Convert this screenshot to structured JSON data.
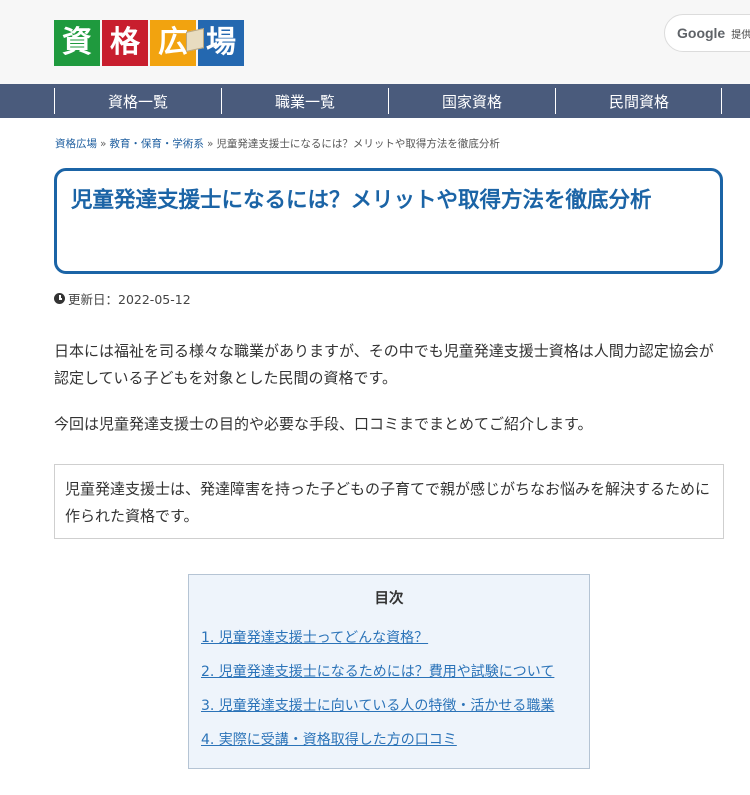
{
  "header": {
    "logo": {
      "chars": [
        "資",
        "格",
        "広",
        "場"
      ],
      "colors": [
        "#1f9a3e",
        "#c81e2e",
        "#f2a30f",
        "#2468b0"
      ]
    },
    "google_button": {
      "brand": "Google",
      "label_fragment": "提供"
    }
  },
  "nav": {
    "items": [
      "資格一覧",
      "職業一覧",
      "国家資格",
      "民間資格"
    ]
  },
  "breadcrumb": {
    "items": [
      "資格広場",
      "教育・保育・学術系",
      "児童発達支援士になるには？メリットや取得方法を徹底分析"
    ],
    "separator": "»"
  },
  "article": {
    "title": "児童発達支援士になるには？メリットや取得方法を徹底分析",
    "updated": "更新日：2022-05-12",
    "paragraphs": [
      "日本には福祉を司る様々な職業がありますが、その中でも児童発達支援士資格は人間力認定協会が認定している子どもを対象とした民間の資格です。",
      "今回は児童発達支援士の目的や必要な手段、口コミまでまとめてご紹介します。"
    ],
    "summary": "児童発達支援士は、発達障害を持った子どもの子育てで親が感じがちなお悩みを解決するために作られた資格です。"
  },
  "toc": {
    "title": "目次",
    "items": [
      "1. 児童発達支援士ってどんな資格？",
      "2. 児童発達支援士になるためには？費用や試験について",
      "3. 児童発達支援士に向いている人の特徴・活かせる職業",
      "4. 実際に受講・資格取得した方の口コミ"
    ]
  },
  "colors": {
    "accent": "#1b64a6",
    "nav_bg": "#4a5b7c",
    "toc_bg": "#eef4fb",
    "link": "#2b73b8"
  }
}
